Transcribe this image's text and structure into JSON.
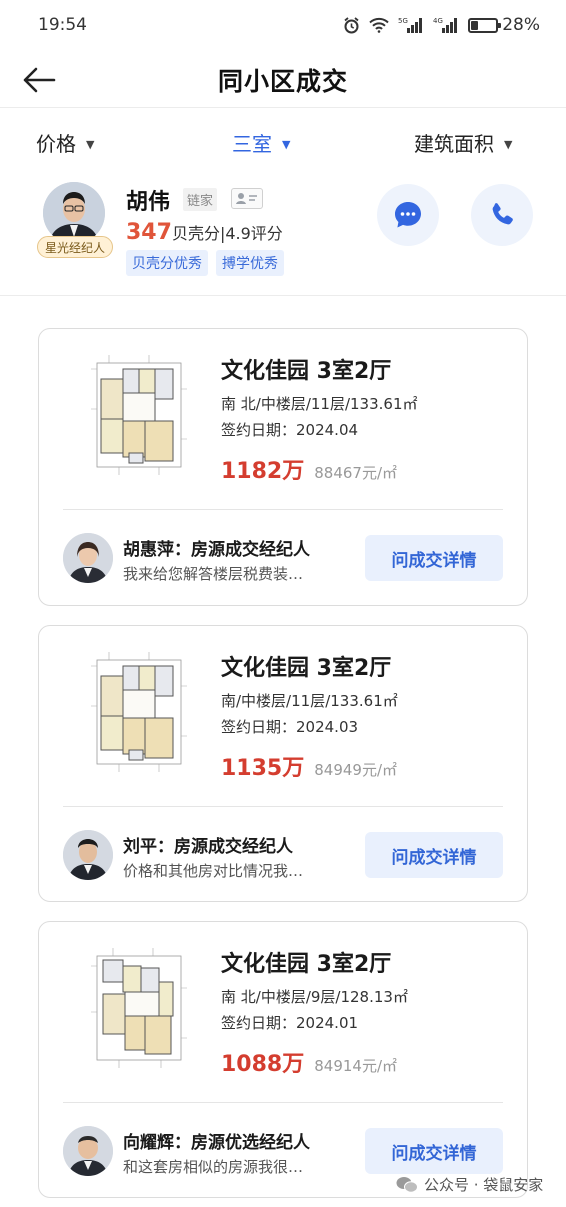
{
  "status_bar": {
    "time": "19:54",
    "battery": "28%",
    "battery_level": 0.28,
    "net1": "5G",
    "net2": "4G"
  },
  "header": {
    "title": "同小区成交"
  },
  "filters": [
    {
      "label": "价格",
      "active": false
    },
    {
      "label": "三室",
      "active": true
    },
    {
      "label": "建筑面积",
      "active": false
    }
  ],
  "agent": {
    "name": "胡伟",
    "brand": "链家",
    "badge": "星光经纪人",
    "score": "347",
    "score_suffix": "贝壳分|4.9评分",
    "tags": [
      "贝壳分优秀",
      "搏学优秀"
    ]
  },
  "listings": [
    {
      "title": "文化佳园 3室2厅",
      "detail": "南 北/中楼层/11层/133.61㎡",
      "sign_date": "签约日期：2024.04",
      "price": "1182万",
      "unit_price": "88467元/㎡",
      "agent_name": "胡惠萍：房源成交经纪人",
      "agent_msg": "我来给您解答楼层税费装…",
      "button": "问成交详情"
    },
    {
      "title": "文化佳园 3室2厅",
      "detail": "南/中楼层/11层/133.61㎡",
      "sign_date": "签约日期：2024.03",
      "price": "1135万",
      "unit_price": "84949元/㎡",
      "agent_name": "刘平：房源成交经纪人",
      "agent_msg": "价格和其他房对比情况我…",
      "button": "问成交详情"
    },
    {
      "title": "文化佳园 3室2厅",
      "detail": "南 北/中楼层/9层/128.13㎡",
      "sign_date": "签约日期：2024.01",
      "price": "1088万",
      "unit_price": "84914元/㎡",
      "agent_name": "向耀辉：房源优选经纪人",
      "agent_msg": "和这套房相似的房源我很…",
      "button": "问成交详情"
    }
  ],
  "watermark": "公众号 · 袋鼠安家",
  "colors": {
    "accent": "#3366e0",
    "price": "#d43d2f",
    "score": "#e0553a"
  }
}
